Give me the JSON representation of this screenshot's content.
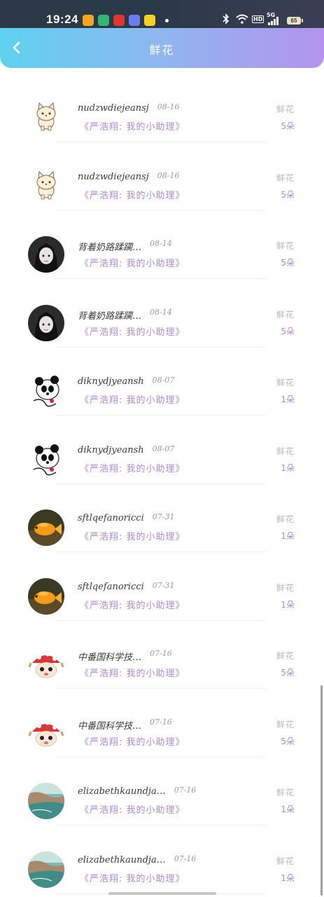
{
  "status_bar": {
    "time": "19:24",
    "app_icons": [
      {
        "name": "weibo-icon",
        "color": "#f5a623"
      },
      {
        "name": "camera-app-icon",
        "color": "#2fb67a"
      },
      {
        "name": "netease-music-icon",
        "color": "#e0362f"
      },
      {
        "name": "photo-app-icon",
        "color": "#6b7cf0"
      },
      {
        "name": "vy-app-icon",
        "color": "#f5d21b"
      }
    ],
    "signal_label": "5G",
    "hd_label": "HD",
    "battery": "65"
  },
  "header": {
    "title": "鲜花",
    "gradient_start": "#5fd2ee",
    "gradient_end": "#b493ee"
  },
  "items": [
    {
      "name": "nudzwdiejeansj",
      "date": "08-16",
      "message": "《严浩翔: 我的小助理》",
      "right_title": "鲜花",
      "count": "5朵",
      "avatar": "cat"
    },
    {
      "name": "nudzwdiejeansj",
      "date": "08-16",
      "message": "《严浩翔: 我的小助理》",
      "right_title": "鲜花",
      "count": "5朵",
      "avatar": "cat"
    },
    {
      "name": "背着奶路蹂躏…",
      "date": "08-14",
      "message": "《严浩翔: 我的小助理》",
      "right_title": "鲜花",
      "count": "5朵",
      "avatar": "girl"
    },
    {
      "name": "背着奶路蹂躏…",
      "date": "08-14",
      "message": "《严浩翔: 我的小助理》",
      "right_title": "鲜花",
      "count": "5朵",
      "avatar": "girl"
    },
    {
      "name": "diknydjyeansh",
      "date": "08-07",
      "message": "《严浩翔: 我的小助理》",
      "right_title": "鲜花",
      "count": "1朵",
      "avatar": "panda"
    },
    {
      "name": "diknydjyeansh",
      "date": "08-07",
      "message": "《严浩翔: 我的小助理》",
      "right_title": "鲜花",
      "count": "1朵",
      "avatar": "panda"
    },
    {
      "name": "sftlqefanoricci",
      "date": "07-31",
      "message": "《严浩翔: 我的小助理》",
      "right_title": "鲜花",
      "count": "1朵",
      "avatar": "fish"
    },
    {
      "name": "sftlqefanoricci",
      "date": "07-31",
      "message": "《严浩翔: 我的小助理》",
      "right_title": "鲜花",
      "count": "1朵",
      "avatar": "fish"
    },
    {
      "name": "中番国科学技…",
      "date": "07-16",
      "message": "《严浩翔: 我的小助理》",
      "right_title": "鲜花",
      "count": "5朵",
      "avatar": "mushroom"
    },
    {
      "name": "中番国科学技…",
      "date": "07-16",
      "message": "《严浩翔: 我的小助理》",
      "right_title": "鲜花",
      "count": "5朵",
      "avatar": "mushroom"
    },
    {
      "name": "elizabethkaundja…",
      "date": "07-16",
      "message": "《严浩翔: 我的小助理》",
      "right_title": "鲜花",
      "count": "1朵",
      "avatar": "sea"
    },
    {
      "name": "elizabethkaundja…",
      "date": "07-16",
      "message": "《严浩翔: 我的小助理》",
      "right_title": "鲜花",
      "count": "1朵",
      "avatar": "sea"
    }
  ]
}
